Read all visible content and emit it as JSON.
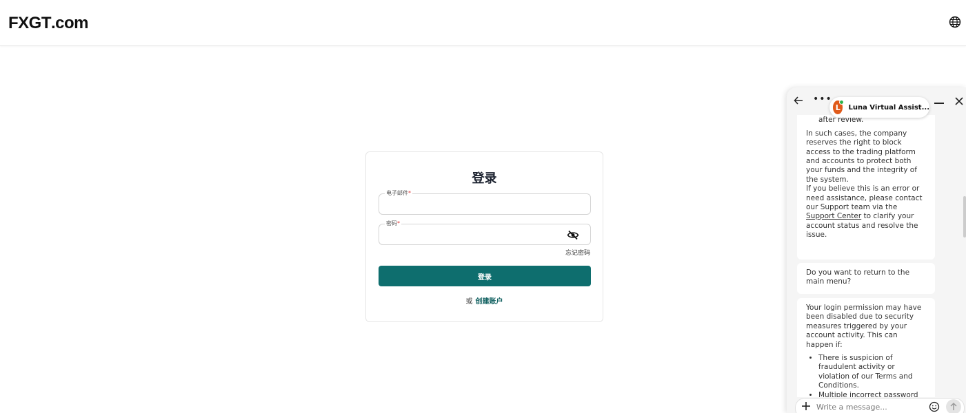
{
  "header": {
    "logo": {
      "part1": "FX",
      "part2": "GT",
      "part3": ".com"
    },
    "language_icon": "globe-icon"
  },
  "login": {
    "title": "登录",
    "email_label": "电子邮件",
    "password_label": "密码",
    "required_mark": "*",
    "forgot_password": "忘记密码",
    "submit_label": "登录",
    "or_text": "或",
    "create_account": "创建账户",
    "accent_color": "#0e6e6e"
  },
  "chat": {
    "agent_initial": "L",
    "agent_name": "Luna Virtual Assist...",
    "messages": [
      {
        "list_tail": "or were found insufficient after review.",
        "para1": "In such cases, the company reserves the right to block access to the trading platform and accounts to protect both your funds and the integrity of the system.",
        "para2_before": "If you believe this is an error or need assistance, please contact our Support team via the ",
        "para2_link": "Support Center",
        "para2_after": " to clarify your account status and resolve the issue."
      },
      {
        "text": "Do you want to return to the main menu?"
      },
      {
        "intro": "Your login permission may have been disabled due to security measures triggered by your account activity. This can happen if:",
        "items": [
          "There is suspicion of fraudulent activity or violation of our Terms and Conditions.",
          "Multiple incorrect password attempts have caused your"
        ]
      }
    ],
    "input_placeholder": "Write a message..."
  }
}
